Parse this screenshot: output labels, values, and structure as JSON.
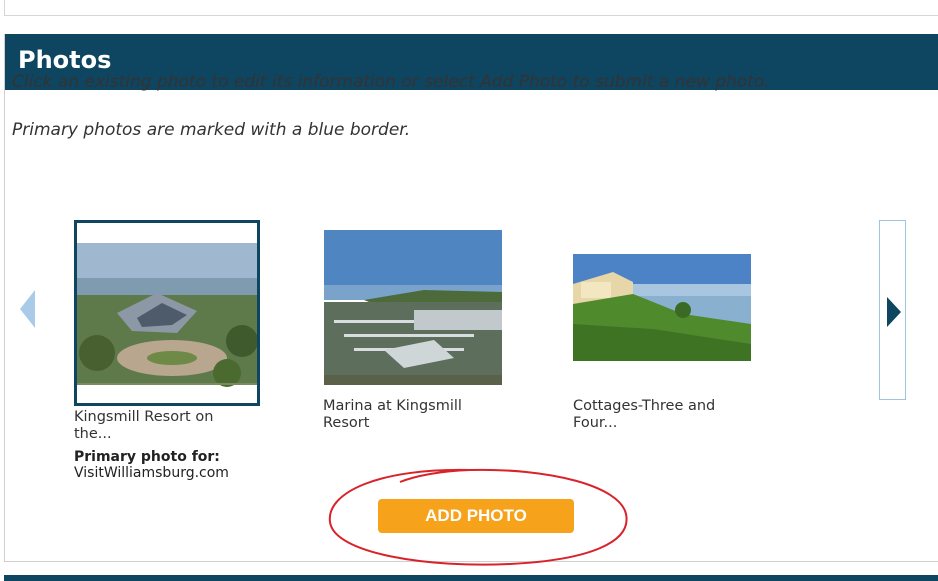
{
  "section": {
    "title": "Photos",
    "instruction_1": "Click an existing photo to edit its information or select Add Photo to submit a new photo.",
    "instruction_2": "Primary photos are marked with a blue border."
  },
  "carousel": {
    "prev_icon": "chevron-left-icon",
    "next_icon": "chevron-right-icon",
    "photos": [
      {
        "caption_line1": "Kingsmill Resort on",
        "caption_line2": "the...",
        "primary": true,
        "primary_label": "Primary photo for:",
        "primary_site": "VisitWilliamsburg.com"
      },
      {
        "caption_line1": "Marina at Kingsmill",
        "caption_line2": "Resort",
        "primary": false
      },
      {
        "caption_line1": "Cottages-Three and",
        "caption_line2": "Four...",
        "primary": false
      }
    ]
  },
  "actions": {
    "add_photo_label": "ADD PHOTO"
  },
  "colors": {
    "header_bg": "#0e4560",
    "button_bg": "#f6a21b",
    "primary_border": "#0e4560",
    "annotation": "#d9232a"
  }
}
